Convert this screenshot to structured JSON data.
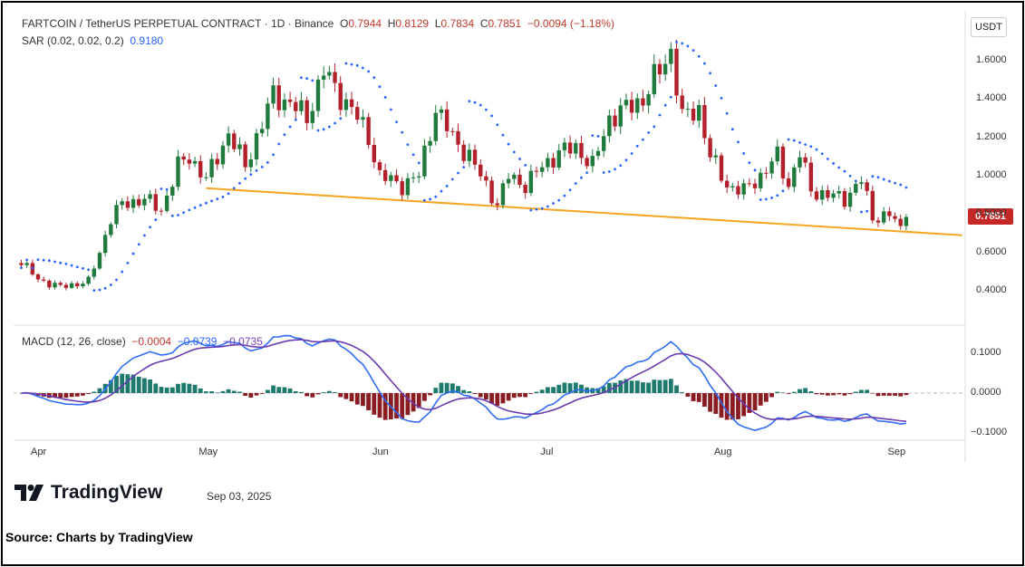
{
  "header": {
    "symbol": "FARTCOIN / TetherUS PERPETUAL CONTRACT · 1D · Binance",
    "o_label": "O",
    "o": "0.7944",
    "h_label": "H",
    "h": "0.8129",
    "l_label": "L",
    "l": "0.7834",
    "c_label": "C",
    "c": "0.7851",
    "change": "−0.0094 (−1.18%)"
  },
  "sar_legend": {
    "label": "SAR (0.02, 0.02, 0.2)",
    "value": "0.9180"
  },
  "macd_legend": {
    "label": "MACD (12, 26, close)",
    "hist": "−0.0004",
    "macd": "−0.0739",
    "signal": "−0.0735"
  },
  "currency": "USDT",
  "last_price": "0.7851",
  "footer": {
    "brand": "TradingView",
    "date": "Sep 03, 2025",
    "source": "Source: Charts by TradingView"
  },
  "colors": {
    "up": "#1f7a3c",
    "down": "#b3202a",
    "sar": "#2962ff",
    "trend": "#f5a623",
    "macd": "#2f6df6",
    "signal": "#6a3bb0",
    "hist_up": "#1e7a6c",
    "hist_down": "#8b1c22"
  },
  "chart_data": {
    "type": "candlestick",
    "title": "FARTCOIN / TetherUS PERPETUAL CONTRACT · 1D · Binance",
    "x_unit": "day offset from Apr 1, 2025",
    "price_ticks": [
      "1.6000",
      "1.4000",
      "1.2000",
      "1.0000",
      "0.8000",
      "0.6000",
      "0.4000"
    ],
    "macd_ticks": [
      "0.1000",
      "0.0000",
      "−0.1000"
    ],
    "time_ticks": [
      {
        "label": "Apr",
        "day": 0
      },
      {
        "label": "May",
        "day": 30
      },
      {
        "label": "Jun",
        "day": 61
      },
      {
        "label": "Jul",
        "day": 91
      },
      {
        "label": "Aug",
        "day": 122
      },
      {
        "label": "Sep",
        "day": 153
      }
    ],
    "close_keypoints": [
      [
        -3,
        0.55
      ],
      [
        0,
        0.46
      ],
      [
        4,
        0.42
      ],
      [
        9,
        0.45
      ],
      [
        11,
        0.6
      ],
      [
        13,
        0.78
      ],
      [
        15,
        0.85
      ],
      [
        19,
        0.88
      ],
      [
        22,
        0.82
      ],
      [
        25,
        1.05
      ],
      [
        27,
        1.1
      ],
      [
        30,
        0.98
      ],
      [
        34,
        1.22
      ],
      [
        37,
        1.05
      ],
      [
        39,
        1.2
      ],
      [
        42,
        1.42
      ],
      [
        45,
        1.38
      ],
      [
        48,
        1.3
      ],
      [
        51,
        1.55
      ],
      [
        53,
        1.45
      ],
      [
        56,
        1.35
      ],
      [
        59,
        1.2
      ],
      [
        61,
        1.0
      ],
      [
        65,
        0.95
      ],
      [
        68,
        1.0
      ],
      [
        71,
        1.35
      ],
      [
        74,
        1.2
      ],
      [
        77,
        1.1
      ],
      [
        80,
        0.95
      ],
      [
        82,
        0.85
      ],
      [
        84,
        1.0
      ],
      [
        87,
        0.95
      ],
      [
        90,
        1.05
      ],
      [
        93,
        1.12
      ],
      [
        96,
        1.15
      ],
      [
        99,
        1.05
      ],
      [
        102,
        1.3
      ],
      [
        105,
        1.35
      ],
      [
        108,
        1.4
      ],
      [
        110,
        1.5
      ],
      [
        113,
        1.65
      ],
      [
        115,
        1.3
      ],
      [
        118,
        1.35
      ],
      [
        120,
        1.1
      ],
      [
        123,
        0.95
      ],
      [
        126,
        0.92
      ],
      [
        129,
        1.0
      ],
      [
        132,
        1.1
      ],
      [
        134,
        0.95
      ],
      [
        136,
        1.12
      ],
      [
        138,
        0.92
      ],
      [
        141,
        0.9
      ],
      [
        144,
        0.88
      ],
      [
        147,
        0.98
      ],
      [
        149,
        0.78
      ],
      [
        152,
        0.8
      ],
      [
        154,
        0.72
      ],
      [
        155,
        0.7851
      ]
    ],
    "trendline": [
      [
        30,
        0.935
      ],
      [
        165,
        0.69
      ]
    ]
  }
}
